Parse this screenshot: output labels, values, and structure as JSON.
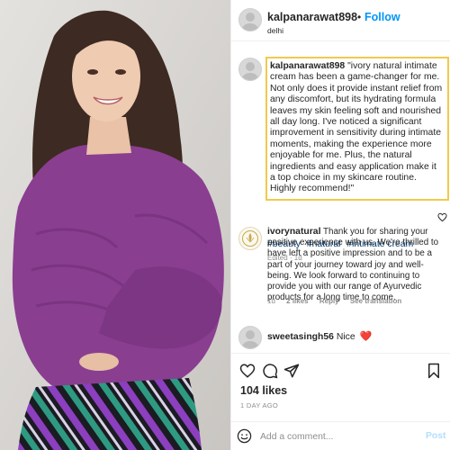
{
  "post": {
    "username": "kalpanarawat898",
    "follow_separator": "•",
    "follow_label": "Follow",
    "location": "delhi",
    "caption_username": "kalpanarawat898",
    "caption_text": "\"ivory natural intimate cream has been a game-changer for me. Not only does it provide instant relief from any discomfort, but its hydrating formula leaves my skin feeling soft and nourished all day long. I've noticed a significant improvement in sensitivity during intimate moments, making the experience more enjoyable for me. Plus, the natural ingredients and easy application make it a top choice in my skincare routine. Highly recommend!\"",
    "hashtags": [
      "#beauty",
      "#natural",
      "#intimate cream"
    ],
    "caption_meta": "Edited · 1d"
  },
  "comments": [
    {
      "username": "ivorynatural",
      "text": "Thank you for sharing your positive experience with us. We're thrilled to have left a positive impression and to be a part of your journey toward joy and well-being. We look forward to continuing to provide you with our range of Ayurvedic products for a long time to come.",
      "time": "1d",
      "likes": "2 likes",
      "reply_label": "Reply",
      "translation_label": "See translation"
    },
    {
      "username": "sweetasingh56",
      "text": "Nice",
      "emoji": "❤️"
    }
  ],
  "footer": {
    "likes": "104 likes",
    "time_ago": "1 DAY AGO",
    "comment_placeholder": "Add a comment...",
    "post_label": "Post"
  },
  "icons": {
    "like": "heart-icon",
    "comment": "comment-icon",
    "share": "send-icon",
    "save": "bookmark-icon",
    "emoji": "smiley-icon"
  },
  "colors": {
    "accent": "#0095f6",
    "highlight_border": "#f2c94c",
    "hashtag": "#00376b",
    "muted": "#8e8e8e",
    "heart": "#ed4956"
  }
}
